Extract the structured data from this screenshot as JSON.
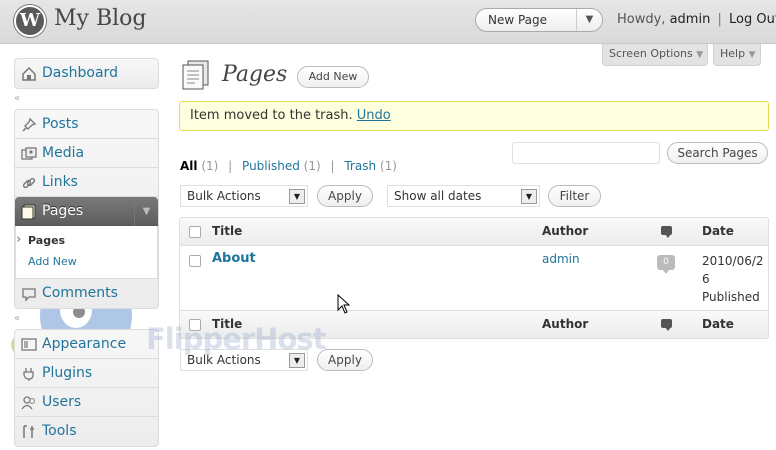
{
  "header": {
    "logo_glyph": "W",
    "site_title": "My Blog",
    "favorite_action": "New Page",
    "greeting": "Howdy,",
    "username": "admin",
    "separator": "|",
    "logout": "Log Out"
  },
  "screen_meta": {
    "screen_options": "Screen Options",
    "help": "Help",
    "arrow": "▼"
  },
  "sidebar": {
    "collapse_glyph": "«",
    "items": [
      {
        "label": "Dashboard",
        "icon": "dashboard-icon"
      },
      {
        "label": "Posts",
        "icon": "pin-icon"
      },
      {
        "label": "Media",
        "icon": "media-icon"
      },
      {
        "label": "Links",
        "icon": "link-icon"
      },
      {
        "label": "Pages",
        "icon": "pages-icon"
      },
      {
        "label": "Comments",
        "icon": "comment-icon"
      },
      {
        "label": "Appearance",
        "icon": "appearance-icon"
      },
      {
        "label": "Plugins",
        "icon": "plugin-icon"
      },
      {
        "label": "Users",
        "icon": "users-icon"
      },
      {
        "label": "Tools",
        "icon": "tools-icon"
      }
    ],
    "pages_submenu": [
      "Pages",
      "Add New"
    ]
  },
  "main": {
    "title": "Pages",
    "add_new": "Add New",
    "notice_text": "Item moved to the trash.",
    "notice_undo": "Undo",
    "filters": {
      "all": "All",
      "all_count": "(1)",
      "published": "Published",
      "published_count": "(1)",
      "trash": "Trash",
      "trash_count": "(1)",
      "sep": "|"
    },
    "search_value": "",
    "search_button": "Search Pages",
    "bulk_actions": "Bulk Actions",
    "apply": "Apply",
    "dates": "Show all dates",
    "filter": "Filter"
  },
  "table": {
    "columns": {
      "title": "Title",
      "author": "Author",
      "date": "Date"
    },
    "rows": [
      {
        "title": "About",
        "author": "admin",
        "comments": "0",
        "date": "2010/06/26",
        "status": "Published"
      }
    ]
  },
  "watermark": "FlipperHost",
  "colors": {
    "link": "#21759b",
    "notice_bg": "#ffffe0",
    "notice_border": "#e6db55",
    "current_menu": "#6d6d6d"
  }
}
